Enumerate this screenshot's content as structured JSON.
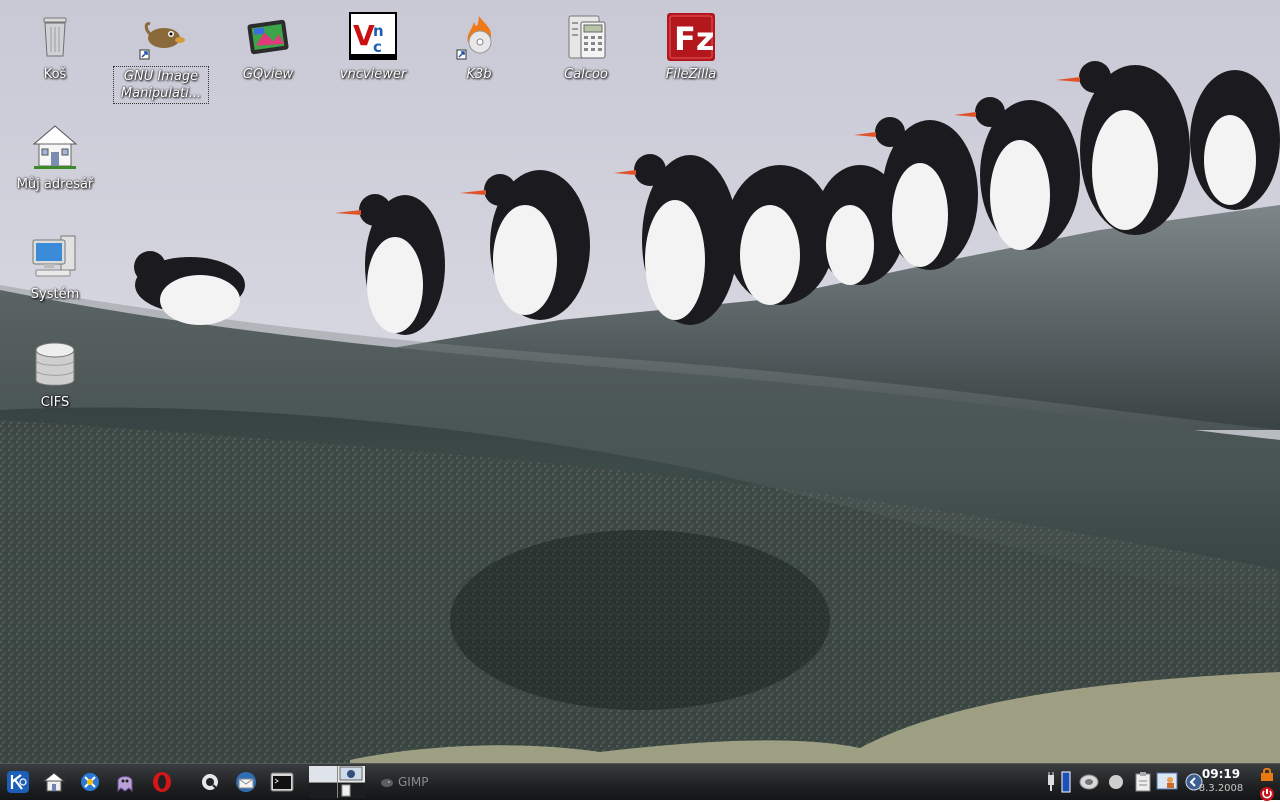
{
  "desktop": {
    "icons": [
      {
        "label": "Koš",
        "icon": "trash-icon"
      },
      {
        "label": "GNU Image Manipulati...",
        "icon": "gimp-icon"
      },
      {
        "label": "GQview",
        "icon": "gqview-icon"
      },
      {
        "label": "vncviewer",
        "icon": "vnc-icon"
      },
      {
        "label": "K3b",
        "icon": "k3b-icon"
      },
      {
        "label": "Calcoo",
        "icon": "calculator-icon"
      },
      {
        "label": "FileZilla",
        "icon": "filezilla-icon"
      },
      {
        "label": "Můj adresář",
        "icon": "home-folder-icon"
      },
      {
        "label": "Systém",
        "icon": "computer-icon"
      },
      {
        "label": "CIFS",
        "icon": "network-drive-icon"
      }
    ],
    "vnc_logo": "VNC",
    "filezilla_logo": "Fz"
  },
  "taskbar": {
    "launchers": [
      "kde-menu-icon",
      "home-icon",
      "konqueror-icon",
      "ghost-icon",
      "opera-icon",
      "quicktime-icon",
      "thunderbird-icon",
      "terminal-icon"
    ],
    "task_gimp": "GIMP",
    "tray": [
      "power-plug-icon",
      "battery-icon",
      "network-icon",
      "disk-icon",
      "clipboard-icon",
      "user-icon",
      "update-icon"
    ],
    "clock": {
      "time": "09:19",
      "date": "8.3.2008"
    }
  },
  "colors": {
    "taskbar_bg": "#1f2123",
    "label_text": "#ffffff",
    "vnc_red": "#cc1010",
    "filezilla_red": "#b3171b"
  }
}
